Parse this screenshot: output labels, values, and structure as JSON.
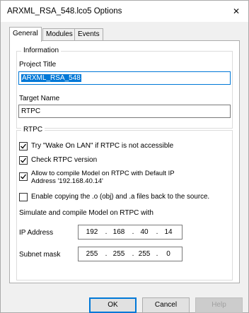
{
  "window": {
    "title": "ARXML_RSA_548.lco5 Options",
    "close_glyph": "✕"
  },
  "tabs": [
    {
      "label": "General",
      "active": true
    },
    {
      "label": "Modules",
      "active": false
    },
    {
      "label": "Events",
      "active": false
    }
  ],
  "information": {
    "legend": "Information",
    "project_title_label": "Project Title",
    "project_title_value": "ARXML_RSA_548",
    "target_name_label": "Target Name",
    "target_name_value": "RTPC"
  },
  "rtpc": {
    "legend": "RTPC",
    "options": [
      {
        "label": "Try \"Wake On LAN\" if RTPC is not accessible",
        "checked": true
      },
      {
        "label": "Check RTPC version",
        "checked": true
      },
      {
        "label_line1": "Allow to compile Model on RTPC with Default IP",
        "label_line2": "Address '192.168.40.14'",
        "checked": true
      },
      {
        "label": "Enable copying the .o (obj) and .a files back to the source.",
        "checked": false
      }
    ],
    "simulate_label": "Simulate and compile Model on RTPC with",
    "ip_address_label": "IP Address",
    "ip_octets": [
      "192",
      "168",
      "40",
      "14"
    ],
    "subnet_label": "Subnet mask",
    "subnet_octets": [
      "255",
      "255",
      "255",
      "0"
    ],
    "octet_separator": "."
  },
  "buttons": {
    "ok": "OK",
    "cancel": "Cancel",
    "help": "Help"
  },
  "icons": {
    "close": "close-icon",
    "checkbox": "checkmark-icon"
  },
  "colors": {
    "accent": "#0078d7",
    "dialog_bg": "#f0f0f0",
    "panel_bg": "#ffffff"
  }
}
